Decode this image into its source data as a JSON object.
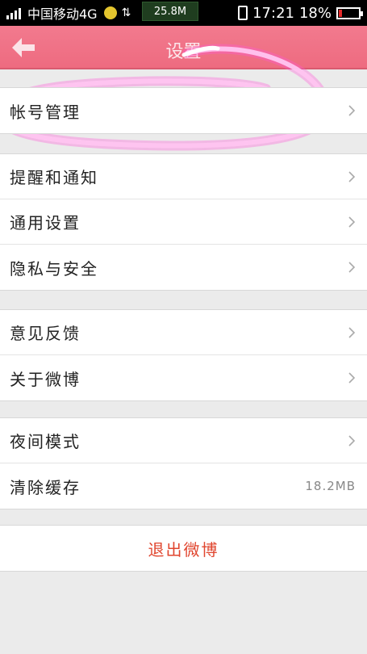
{
  "status_bar": {
    "carrier": "中国移动4G",
    "net_speed": "25.8M",
    "time": "17:21",
    "battery": "18%",
    "battery_level": 0.18,
    "battery_color": "#e32a2a"
  },
  "header": {
    "title": "设置",
    "background": "#f27a8e",
    "back_icon": "back-arrow-icon"
  },
  "groups": [
    {
      "items": [
        {
          "label": "帐号管理",
          "icon": "chevron-right-icon"
        }
      ]
    },
    {
      "items": [
        {
          "label": "提醒和通知",
          "icon": "chevron-right-icon"
        },
        {
          "label": "通用设置",
          "icon": "chevron-right-icon"
        },
        {
          "label": "隐私与安全",
          "icon": "chevron-right-icon"
        }
      ]
    },
    {
      "items": [
        {
          "label": "意见反馈",
          "icon": "chevron-right-icon"
        },
        {
          "label": "关于微博",
          "icon": "chevron-right-icon"
        }
      ]
    },
    {
      "items": [
        {
          "label": "夜间模式",
          "icon": "chevron-right-icon"
        },
        {
          "label": "清除缓存",
          "value": "18.2MB"
        }
      ]
    }
  ],
  "logout": {
    "label": "退出微博",
    "color": "#e0462f"
  }
}
